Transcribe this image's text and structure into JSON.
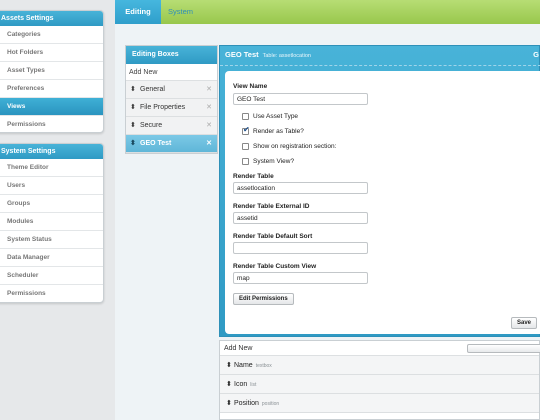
{
  "assets_panel": {
    "title": "Assets Settings",
    "items": [
      "Categories",
      "Hot Folders",
      "Asset Types",
      "Preferences",
      "Views",
      "Permissions"
    ],
    "active_index": 4
  },
  "system_panel": {
    "title": "System Settings",
    "items": [
      "Theme Editor",
      "Users",
      "Groups",
      "Modules",
      "System Status",
      "Data Manager",
      "Scheduler",
      "Permissions"
    ]
  },
  "top_tabs": {
    "editing": "Editing",
    "system": "System"
  },
  "editing_boxes": {
    "title": "Editing Boxes",
    "add_new": "Add New",
    "items": [
      "General",
      "File Properties",
      "Secure",
      "GEO Test"
    ],
    "active_index": 3,
    "remove_glyph": "✕"
  },
  "geo_panel": {
    "title": "GEO Test",
    "subtitle": "Table: assetlocation",
    "corner_letter": "G",
    "view_name_label": "View Name",
    "view_name_value": "GEO Test",
    "checkboxes": [
      {
        "label": "Use Asset Type",
        "checked": false
      },
      {
        "label": "Render as Table?",
        "checked": true
      },
      {
        "label": "Show on registration section:",
        "checked": false
      },
      {
        "label": "System View?",
        "checked": false
      }
    ],
    "render_table_label": "Render Table",
    "render_table_value": "assetlocation",
    "external_id_label": "Render Table External ID",
    "external_id_value": "assetid",
    "default_sort_label": "Render Table Default Sort",
    "default_sort_value": "",
    "custom_view_label": "Render Table Custom View",
    "custom_view_value": "map",
    "edit_permissions_label": "Edit Permissions",
    "save_label": "Save"
  },
  "fields_list": {
    "add_new": "Add New",
    "items": [
      {
        "label": "Name",
        "hint": "textbox"
      },
      {
        "label": "Icon",
        "hint": "list"
      },
      {
        "label": "Position",
        "hint": "position"
      }
    ]
  },
  "icons": {
    "grip": "updown-arrow-icon",
    "remove": "close-icon",
    "check": "checkmark-icon"
  },
  "colors": {
    "accent_blue": "#2f9ac4",
    "topbar_green": "#a6d35f"
  }
}
